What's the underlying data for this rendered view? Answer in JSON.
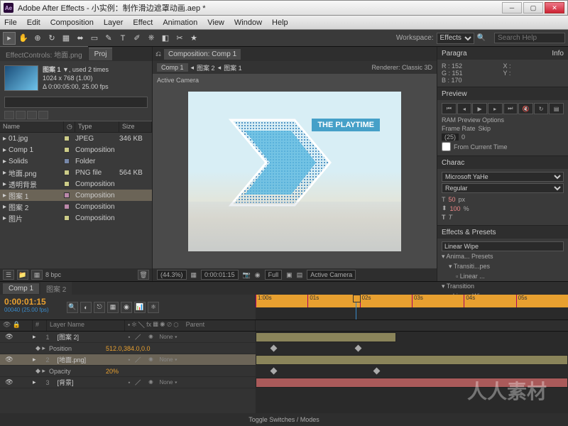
{
  "title": "Adobe After Effects - 小实例：制作滑边遮罩动画.aep *",
  "menu": [
    "File",
    "Edit",
    "Composition",
    "Layer",
    "Effect",
    "Animation",
    "View",
    "Window",
    "Help"
  ],
  "workspace": {
    "label": "Workspace:",
    "value": "Effects",
    "search": "Search Help"
  },
  "project": {
    "tab_eff": "EffectControls: 地面.png",
    "tab_proj": "Proj",
    "item_name": "图案 1 ▼",
    "item_used": ", used 2 times",
    "dims": "1024 x 768 (1.00)",
    "dur": "Δ 0:00:05:00, 25.00 fps",
    "hdr": {
      "name": "Name",
      "type": "Type",
      "size": "Size"
    },
    "rows": [
      {
        "n": "01.jpg",
        "t": "JPEG",
        "s": "346 KB",
        "c": "y"
      },
      {
        "n": "Comp 1",
        "t": "Composition",
        "s": "",
        "c": "y"
      },
      {
        "n": "Solids",
        "t": "Folder",
        "s": "",
        "c": "b"
      },
      {
        "n": "地面.png",
        "t": "PNG file",
        "s": "564 KB",
        "c": "y"
      },
      {
        "n": "透明背景",
        "t": "Composition",
        "s": "",
        "c": "y"
      },
      {
        "n": "图案 1",
        "t": "Composition",
        "s": "",
        "c": "p",
        "sel": true
      },
      {
        "n": "图案 2",
        "t": "Composition",
        "s": "",
        "c": "p"
      },
      {
        "n": "图片",
        "t": "Composition",
        "s": "",
        "c": "y"
      }
    ],
    "bpc": "8 bpc"
  },
  "comp": {
    "tab": "Composition: Comp 1",
    "subs": [
      "Comp 1",
      "图案 2",
      "图案 1"
    ],
    "renderer_l": "Renderer:",
    "renderer": "Classic 3D",
    "active": "Active Camera",
    "playtime": "THE PLAYTIME",
    "zoom": "(44.3%)",
    "time": "0:00:01:15",
    "res": "Full",
    "cam": "Active Camera"
  },
  "right": {
    "paragraph": "Paragra",
    "info": "Info",
    "info_vals": {
      "r": "R : 152",
      "g": "G : 151",
      "b": "B : 170",
      "x": "X :",
      "y": "Y :"
    },
    "char": "Charac",
    "font": "Microsoft YaHe",
    "style": "Regular",
    "size": "50",
    "size_u": "px",
    "track": "100",
    "track_u": "%",
    "preview": "Preview",
    "ram": "RAM Preview Options",
    "frl": "Frame Rate",
    "skip": "Skip",
    "fr": "(25)",
    "sk": "0",
    "fct": "From Current Time",
    "eff": "Effects & Presets",
    "eff_s": "Linear Wipe",
    "tree": [
      "Anima... Presets",
      "Transiti...pes",
      "Linear ...",
      "Transition",
      "Linear Wipe"
    ]
  },
  "tl": {
    "tabs": [
      "Comp 1",
      "图案 2"
    ],
    "tc": "0:00:01:15",
    "fr": "00040 (25.00 fps)",
    "cols": {
      "ln": "Layer Name",
      "mode": "Parent"
    },
    "ticks": [
      "1:00s",
      "01s",
      "02s",
      "03s",
      "04s",
      "05s"
    ],
    "layers": [
      {
        "num": "1",
        "name": "[图案 2]",
        "c": "p",
        "mode": "None"
      },
      {
        "prop": "Position",
        "val": "512.0,384.0,0.0"
      },
      {
        "num": "2",
        "name": "[地面.png]",
        "c": "y",
        "mode": "None",
        "sel": true
      },
      {
        "prop": "Opacity",
        "val": "20%"
      },
      {
        "num": "3",
        "name": "[背景]",
        "c": "y",
        "mode": "None"
      }
    ],
    "toggle": "Toggle Switches / Modes"
  },
  "watermark": "人人素材"
}
